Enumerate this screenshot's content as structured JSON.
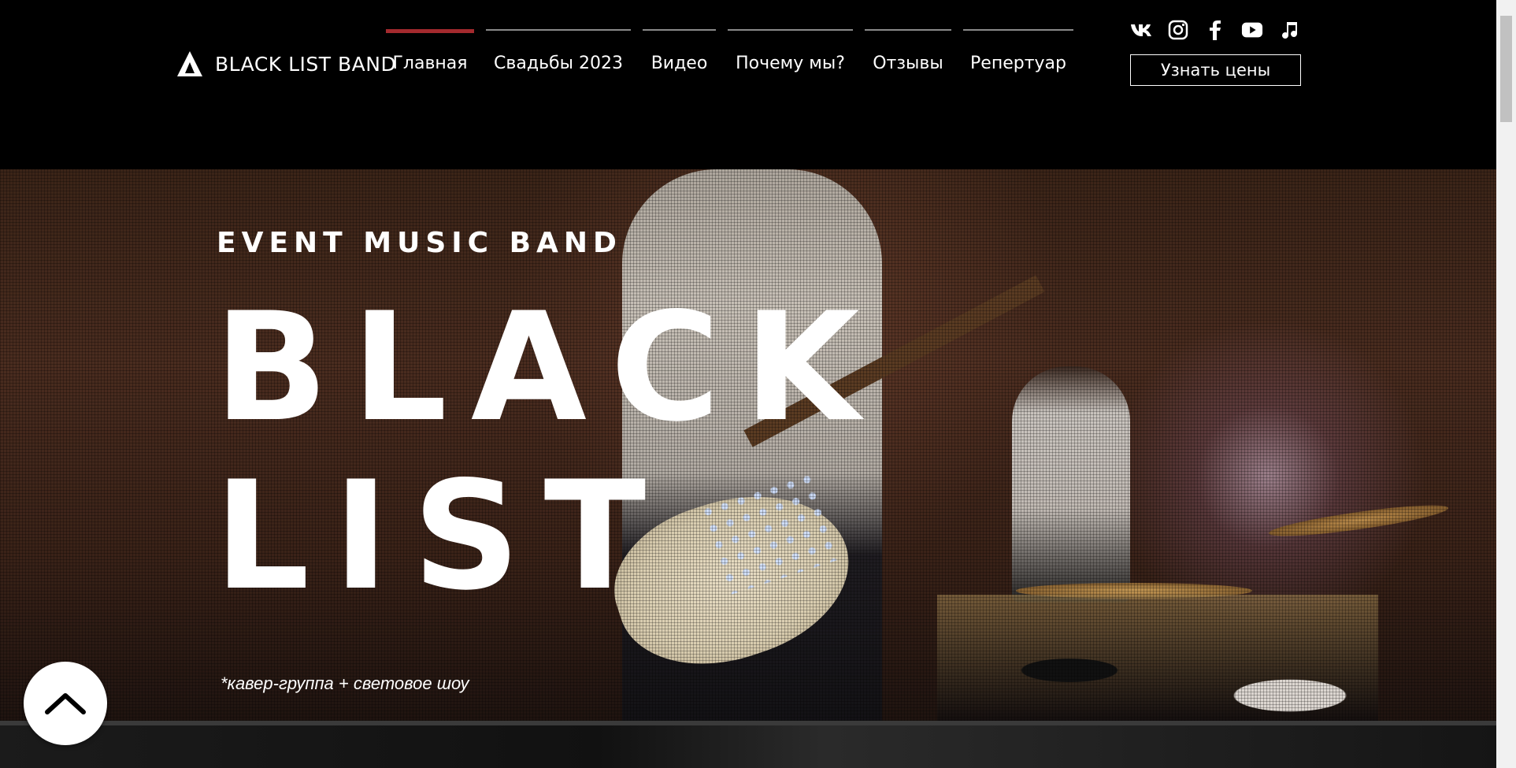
{
  "header": {
    "logo_text": "BLACK LIST BAND",
    "nav": [
      {
        "label": "Главная",
        "active": true
      },
      {
        "label": "Свадьбы 2023",
        "active": false
      },
      {
        "label": "Видео",
        "active": false
      },
      {
        "label": "Почему мы?",
        "active": false
      },
      {
        "label": "Отзывы",
        "active": false
      },
      {
        "label": "Репертуар",
        "active": false
      }
    ],
    "social_icons": [
      "vk-icon",
      "instagram-icon",
      "facebook-icon",
      "youtube-icon",
      "music-note-icon"
    ],
    "price_button": "Узнать цены",
    "accent_color": "#a42a2e"
  },
  "hero": {
    "subtitle": "EVENT MUSIC BAND",
    "title_line1": "BLACK",
    "title_line2": "LIST",
    "note": "*кавер-группа + световое шоу"
  },
  "scroll_top_icon": "chevron-up-icon"
}
